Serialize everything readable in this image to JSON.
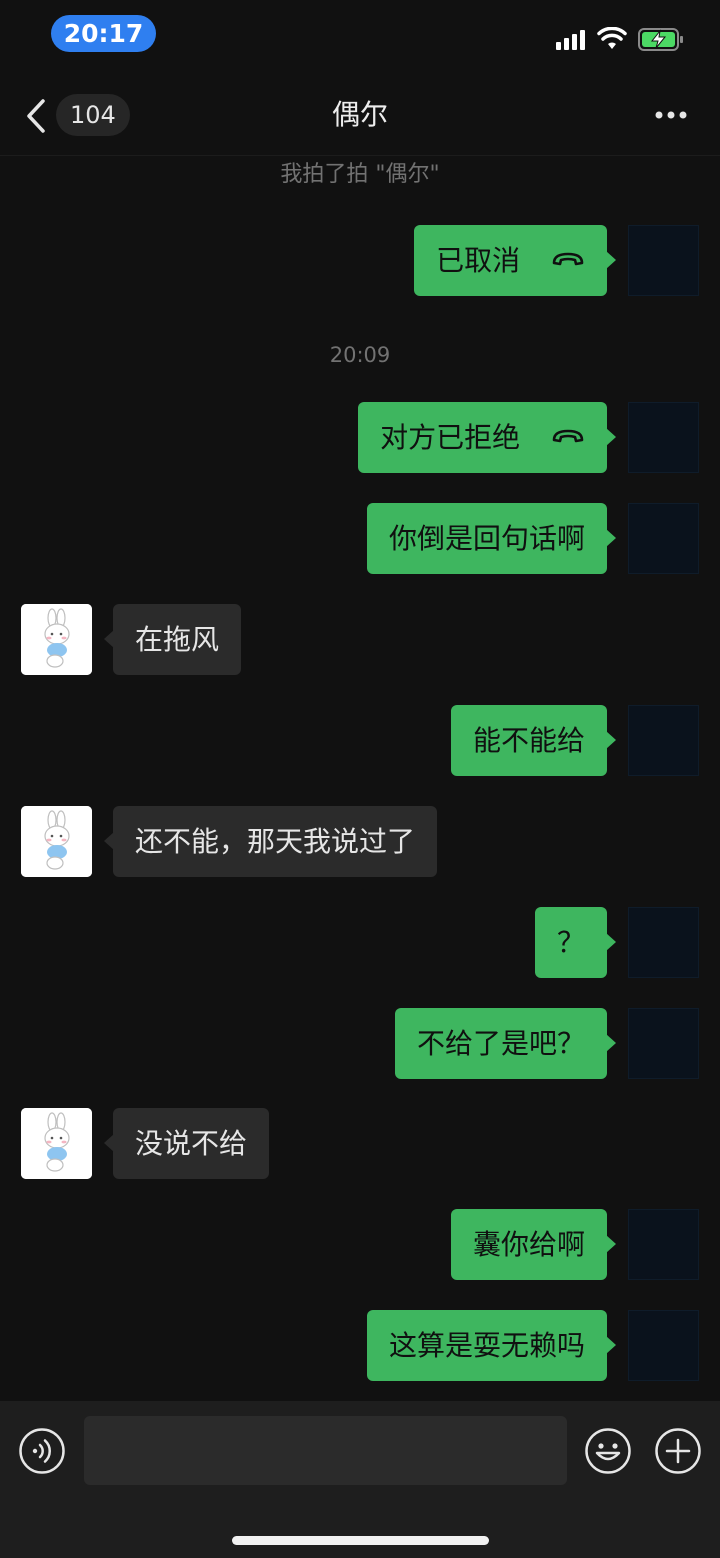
{
  "status_bar": {
    "time": "20:17"
  },
  "nav": {
    "unread_count": "104",
    "title": "偶尔"
  },
  "system_note": "我拍了拍 \"偶尔\"",
  "timestamp": "20:09",
  "messages": [
    {
      "side": "out",
      "text": "已取消",
      "icon": "hangup-icon"
    },
    {
      "side": "out",
      "text": "对方已拒绝",
      "icon": "hangup-icon"
    },
    {
      "side": "out",
      "text": "你倒是回句话啊"
    },
    {
      "side": "in",
      "text": "在拖风"
    },
    {
      "side": "out",
      "text": "能不能给"
    },
    {
      "side": "in",
      "text": "还不能，那天我说过了"
    },
    {
      "side": "out",
      "text": "？"
    },
    {
      "side": "out",
      "text": "不给了是吧？"
    },
    {
      "side": "in",
      "text": "没说不给"
    },
    {
      "side": "out",
      "text": "囊你给啊"
    },
    {
      "side": "out",
      "text": "这算是耍无赖吗"
    }
  ],
  "input_bar": {
    "placeholder": ""
  },
  "colors": {
    "outgoing_bubble": "#3eb65f",
    "incoming_bubble": "#2b2b2b",
    "background": "#111111",
    "time_pill": "#2f7ff0"
  }
}
